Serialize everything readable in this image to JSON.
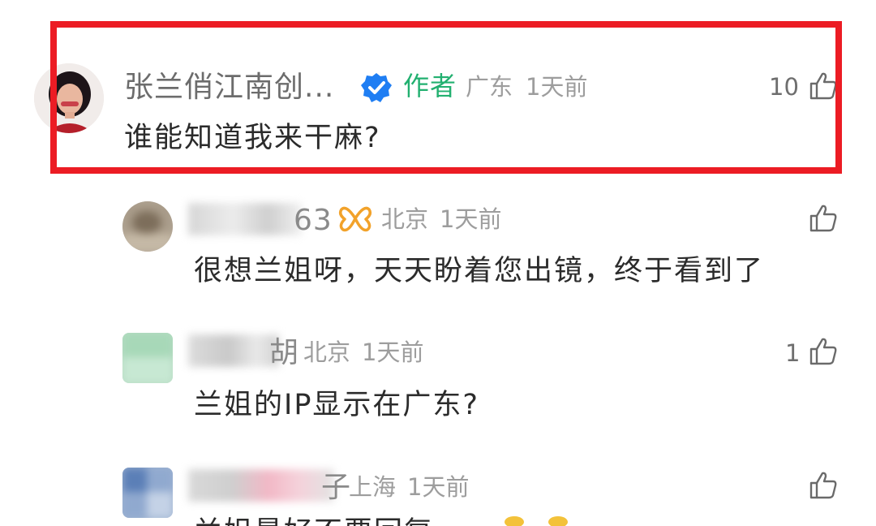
{
  "comments": [
    {
      "name": "张兰俏江南创...",
      "author_badge": "作者",
      "location": "广东",
      "time": "1天前",
      "likes": "10",
      "text": "谁能知道我来干麻?"
    },
    {
      "name_suffix": "63",
      "location": "北京",
      "time": "1天前",
      "likes": "",
      "text": "很想兰姐呀，天天盼着您出镜，终于看到了"
    },
    {
      "name_suffix": "胡",
      "location": "北京",
      "time": "1天前",
      "likes": "1",
      "text": "兰姐的IP显示在广东?"
    },
    {
      "name_suffix": "子",
      "location": "上海",
      "time": "1天前",
      "likes": "",
      "text": "兰姐最好不要回复"
    }
  ],
  "icons": {
    "verified": "verified-badge-icon",
    "like": "thumbs-up-icon",
    "vip": "butterfly-vip-icon"
  },
  "colors": {
    "highlight_border": "#ec1c24",
    "verified_blue": "#1f7ef3",
    "author_green": "#22b070",
    "vip_orange": "#f2a22a"
  }
}
